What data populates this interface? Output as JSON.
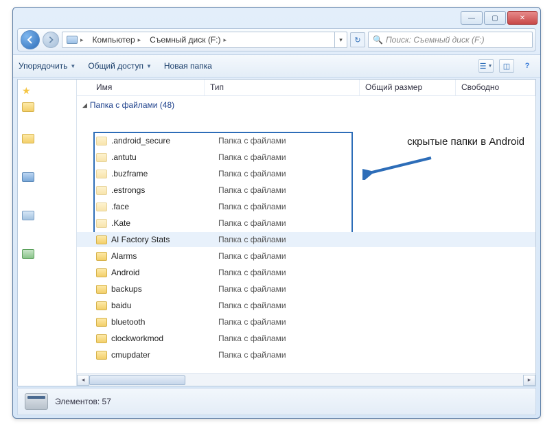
{
  "titlebar": {
    "min": "—",
    "max": "▢",
    "close": "✕"
  },
  "breadcrumb": {
    "seg1": "Компьютер",
    "seg2": "Съемный диск (F:)"
  },
  "search": {
    "placeholder": "Поиск: Съемный диск (F:)"
  },
  "toolbar": {
    "organize": "Упорядочить",
    "share": "Общий доступ",
    "newfolder": "Новая папка"
  },
  "columns": {
    "name": "Имя",
    "type": "Тип",
    "size": "Общий размер",
    "free": "Свободно"
  },
  "group": {
    "label": "Папка с файлами (48)"
  },
  "rows": [
    {
      "name": ".android_secure",
      "type": "Папка с файлами",
      "hidden": true
    },
    {
      "name": ".antutu",
      "type": "Папка с файлами",
      "hidden": true
    },
    {
      "name": ".buzframe",
      "type": "Папка с файлами",
      "hidden": true
    },
    {
      "name": ".estrongs",
      "type": "Папка с файлами",
      "hidden": true
    },
    {
      "name": ".face",
      "type": "Папка с файлами",
      "hidden": true
    },
    {
      "name": ".Kate",
      "type": "Папка с файлами",
      "hidden": true
    },
    {
      "name": "AI Factory Stats",
      "type": "Папка с файлами",
      "hidden": false,
      "sel": true
    },
    {
      "name": "Alarms",
      "type": "Папка с файлами",
      "hidden": false
    },
    {
      "name": "Android",
      "type": "Папка с файлами",
      "hidden": false
    },
    {
      "name": "backups",
      "type": "Папка с файлами",
      "hidden": false
    },
    {
      "name": "baidu",
      "type": "Папка с файлами",
      "hidden": false
    },
    {
      "name": "bluetooth",
      "type": "Папка с файлами",
      "hidden": false
    },
    {
      "name": "clockworkmod",
      "type": "Папка с файлами",
      "hidden": false
    },
    {
      "name": "cmupdater",
      "type": "Папка с файлами",
      "hidden": false
    }
  ],
  "annotation": "скрытые папки в Android",
  "status": {
    "text": "Элементов: 57"
  }
}
